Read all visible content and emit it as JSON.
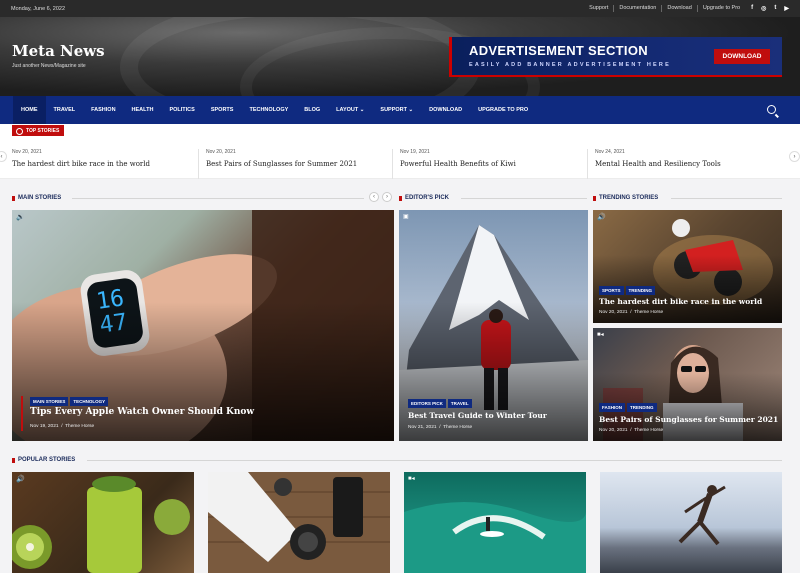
{
  "topbar": {
    "date": "Monday, June 6, 2022",
    "links": [
      "Support",
      "Documentation",
      "Download",
      "Upgrade to Pro"
    ],
    "social": [
      "f",
      "◎",
      "t",
      "▶"
    ]
  },
  "header": {
    "logo": "Meta News",
    "tagline": "Just another News/Magazine site",
    "ad_title": "ADVERTISEMENT SECTION",
    "ad_subtitle": "EASILY ADD BANNER ADVERTISEMENT HERE",
    "ad_button": "DOWNLOAD"
  },
  "nav": {
    "items": [
      "HOME",
      "TRAVEL",
      "FASHION",
      "HEALTH",
      "POLITICS",
      "SPORTS",
      "TECHNOLOGY",
      "BLOG",
      "LAYOUT ⌄",
      "SUPPORT ⌄",
      "DOWNLOAD",
      "UPGRADE TO PRO"
    ]
  },
  "ticker": {
    "label": "TOP STORIES",
    "items": [
      {
        "date": "Nov 20, 2021",
        "title": "The hardest dirt bike race in the world"
      },
      {
        "date": "Nov 20, 2021",
        "title": "Best Pairs of Sunglasses for Summer 2021"
      },
      {
        "date": "Nov 19, 2021",
        "title": "Powerful Health Benefits of Kiwi"
      },
      {
        "date": "Nov 24, 2021",
        "title": "Mental Health and Resiliency Tools"
      }
    ]
  },
  "sections": {
    "main": "MAIN STORIES",
    "editors": "EDITOR'S PICK",
    "trending": "TRENDING STORIES",
    "popular": "POPULAR STORIES"
  },
  "main_story": {
    "tags": [
      "MAIN STORIES",
      "TECHNOLOGY"
    ],
    "title": "Tips Every Apple Watch Owner Should Know",
    "date": "Nov 19, 2021",
    "author": "Theme Horse",
    "watch_time": "16\n47"
  },
  "editor_story": {
    "tags": [
      "EDITORS PICK",
      "TRAVEL"
    ],
    "title": "Best Travel Guide to Winter Tour",
    "date": "Nov 21, 2021",
    "author": "Theme Horse"
  },
  "trending": [
    {
      "tags": [
        "SPORTS",
        "TRENDING"
      ],
      "title": "The hardest dirt bike race in the world",
      "date": "Nov 20, 2021",
      "author": "Theme Horse"
    },
    {
      "tags": [
        "FASHION",
        "TRENDING"
      ],
      "title": "Best Pairs of Sunglasses for Summer 2021",
      "date": "Nov 20, 2021",
      "author": "Theme Horse"
    }
  ],
  "colors": {
    "brand": "#0f2a80",
    "accent": "#c00d0d"
  }
}
